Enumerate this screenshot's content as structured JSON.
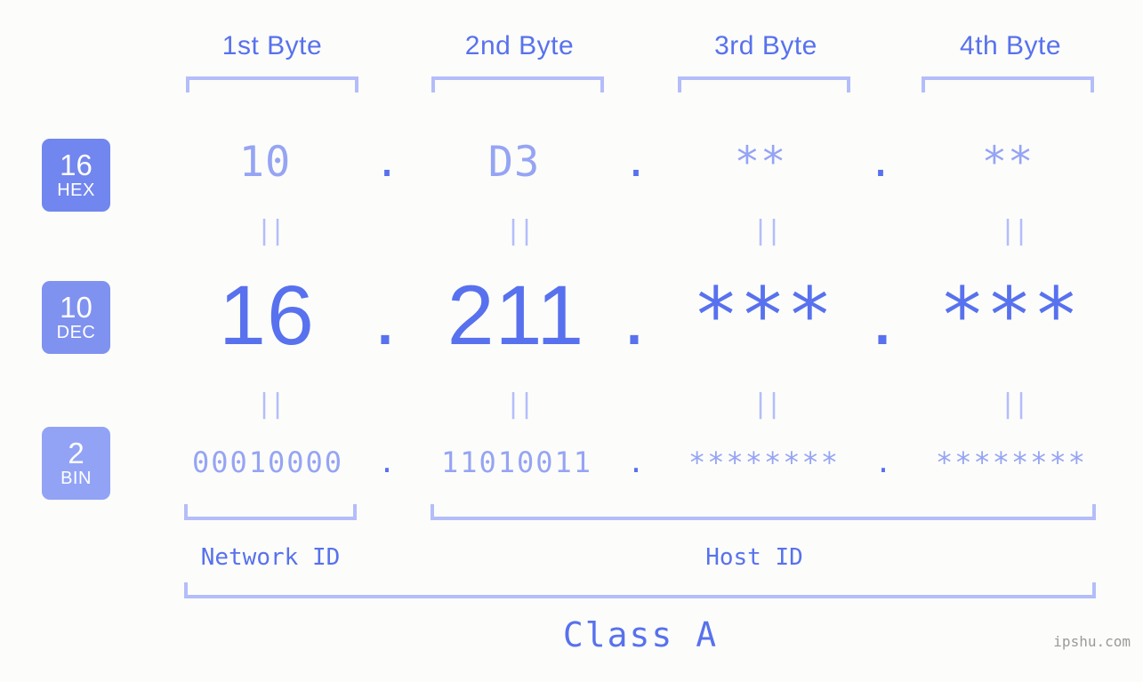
{
  "theme": {
    "background": "#fcfdfa",
    "accent_strong": "#5871ee",
    "accent_light": "#96a4f4",
    "bracket": "#b4bdfa",
    "badge_hex_bg": "#7186ee",
    "badge_dec_bg": "#7f92f0",
    "badge_bin_bg": "#92a3f6",
    "badge_text": "#ffffff",
    "watermark_color": "#9a9a9a"
  },
  "header": {
    "byte_labels": [
      "1st Byte",
      "2nd Byte",
      "3rd Byte",
      "4th Byte"
    ]
  },
  "bases": [
    {
      "number": "16",
      "name": "HEX"
    },
    {
      "number": "10",
      "name": "DEC"
    },
    {
      "number": "2",
      "name": "BIN"
    }
  ],
  "separator": ".",
  "equals_mark": "=",
  "rows": {
    "hex": {
      "base_number": "16",
      "base_name": "HEX",
      "bytes": [
        "10",
        "D3",
        "**",
        "**"
      ]
    },
    "dec": {
      "base_number": "10",
      "base_name": "DEC",
      "bytes": [
        "16",
        "211",
        "***",
        "***"
      ]
    },
    "bin": {
      "base_number": "2",
      "base_name": "BIN",
      "bytes": [
        "00010000",
        "11010011",
        "********",
        "********"
      ]
    }
  },
  "address": {
    "hex": "10.D3.**.**",
    "dec": "16.211.***.***",
    "bin": "00010000.11010011.********.********"
  },
  "footer": {
    "network_id_label": "Network ID",
    "host_id_label": "Host ID",
    "class_label": "Class A",
    "watermark": "ipshu.com"
  }
}
